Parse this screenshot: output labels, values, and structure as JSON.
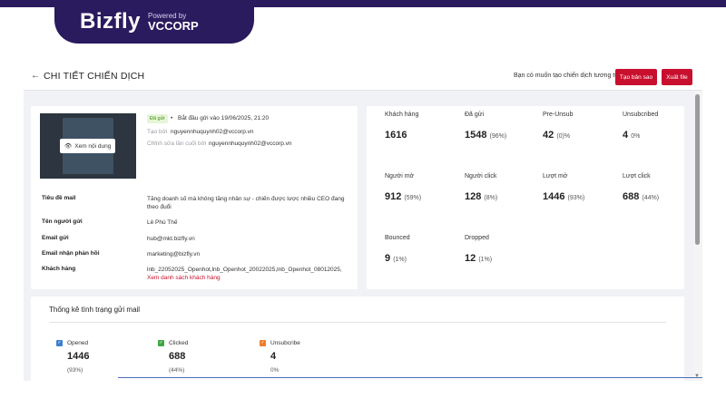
{
  "brand": {
    "name": "Bizfly",
    "powered_by": "Powered by",
    "partner": "VCCORP"
  },
  "header": {
    "back_icon": "arrow-left-icon",
    "title": "CHI TIẾT CHIẾN DỊCH",
    "question": "Bạn có muốn tạo chiến dịch tương tự?",
    "copy_button": "Tạo bản sao",
    "export_button": "Xuất file"
  },
  "campaign": {
    "view_content": "Xem nội dung",
    "status": "Đã gửi",
    "sent_info": "Bắt đầu gửi vào 19/06/2025, 21:20",
    "created_by_label": "Tạo bởi",
    "created_by": "nguyennhuquynh02@vccorp.vn",
    "edited_by_label": "Chỉnh sửa lần cuối bởi",
    "edited_by": "nguyennhuquynh02@vccorp.vn"
  },
  "details": {
    "subject_label": "Tiêu đề mail",
    "subject": "Tăng doanh số mà không tăng nhân sự - chiến được lược nhiều CEO đang theo đuổi",
    "sender_name_label": "Tên người gửi",
    "sender_name": "Lê Phú Thế",
    "sender_email_label": "Email gửi",
    "sender_email": "hub@mkt.bizfly.vn",
    "reply_email_label": "Email nhận phản hồi",
    "reply_email": "marketing@bizfly.vn",
    "customers_label": "Khách hàng",
    "customers": "lnb_22052025_Openhot,lnb_Openhot_20022025,lnb_Openhot_08012025,",
    "customers_link": "Xem danh sách khách hàng"
  },
  "stats": {
    "customers": {
      "label": "Khách hàng",
      "value": "1616"
    },
    "sent": {
      "label": "Đã gửi",
      "value": "1548",
      "pct": "(96%)"
    },
    "pre_unsub": {
      "label": "Pre-Unsub",
      "value": "42",
      "pct": "(0)%"
    },
    "unsubscribed": {
      "label": "Unsubcribed",
      "value": "4",
      "pct": "0%"
    },
    "opened": {
      "label": "Người mở",
      "value": "912",
      "pct": "(59%)"
    },
    "clicked": {
      "label": "Người click",
      "value": "128",
      "pct": "(8%)"
    },
    "opens": {
      "label": "Lượt mở",
      "value": "1446",
      "pct": "(93%)"
    },
    "clicks": {
      "label": "Lượt click",
      "value": "688",
      "pct": "(44%)"
    },
    "bounced": {
      "label": "Bounced",
      "value": "9",
      "pct": "(1%)"
    },
    "dropped": {
      "label": "Dropped",
      "value": "12",
      "pct": "(1%)"
    }
  },
  "chart": {
    "title": "Thống kê tình trạng gửi mail",
    "legend": [
      {
        "label": "Opened",
        "value": "1446",
        "pct": "(93%)",
        "color": "#3b7fd0"
      },
      {
        "label": "Clicked",
        "value": "688",
        "pct": "(44%)",
        "color": "#3fa845"
      },
      {
        "label": "Unsubcribe",
        "value": "4",
        "pct": "0%",
        "color": "#ee7d2b"
      }
    ]
  },
  "colors": {
    "brand_bg": "#2a1a5e",
    "accent_red": "#c8102e"
  }
}
